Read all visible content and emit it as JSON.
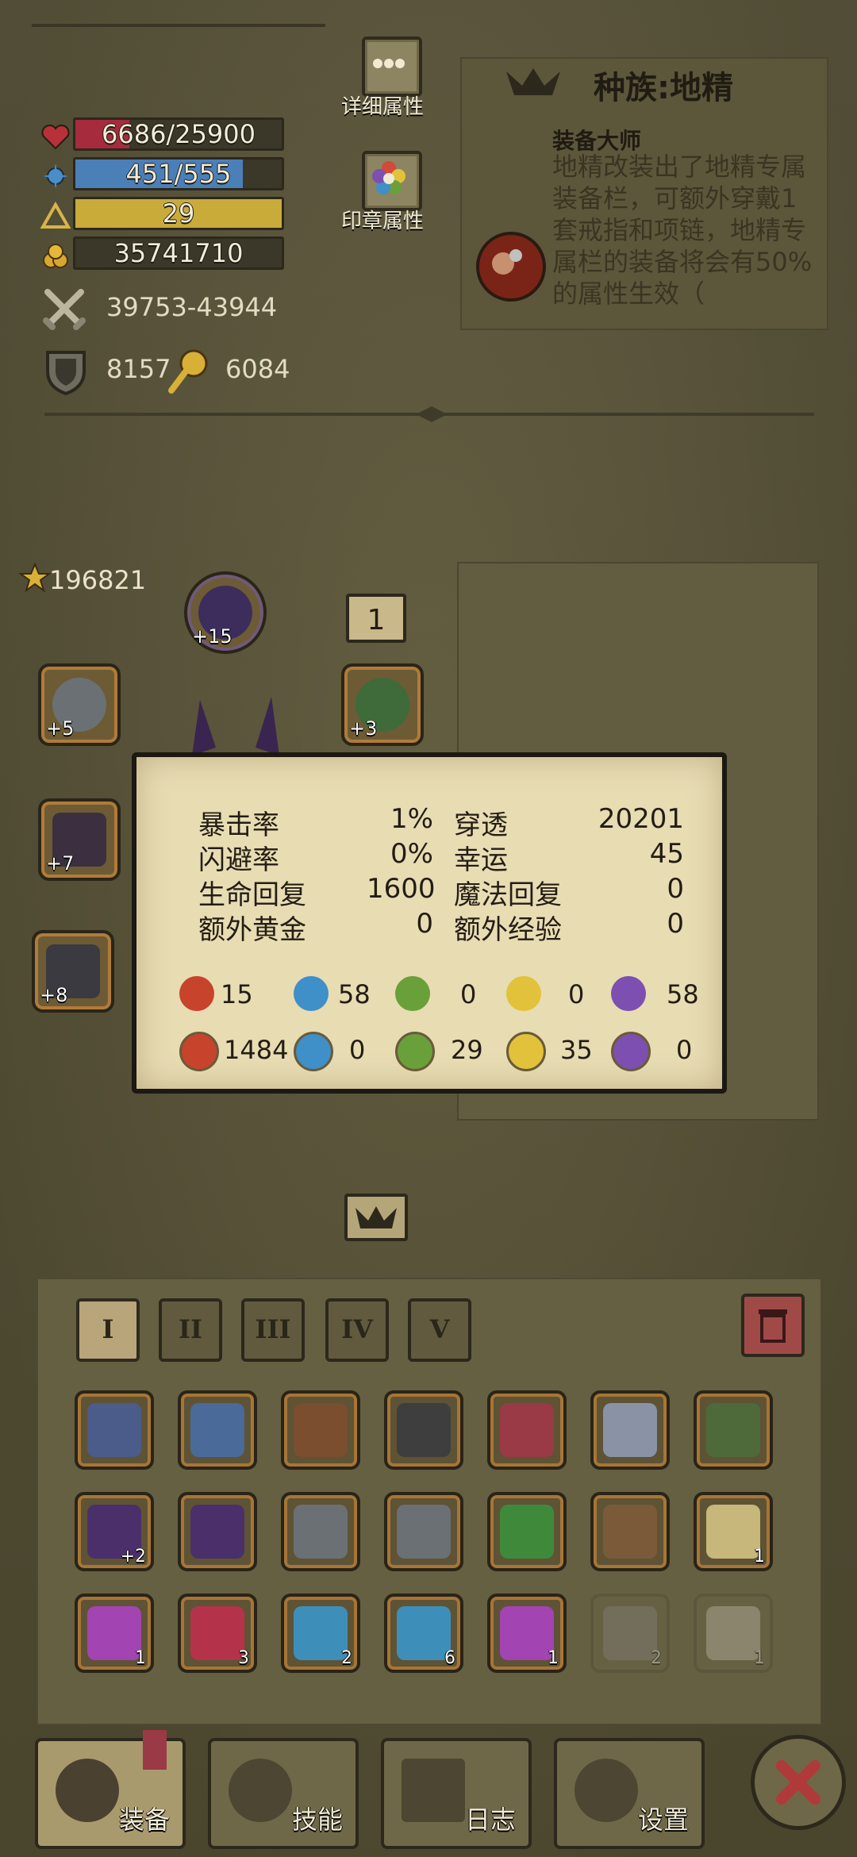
{
  "stats": {
    "hp": "6686/25900",
    "hp_fraction": 0.26,
    "mp": "451/555",
    "mp_fraction": 0.81,
    "level": "29",
    "gold": "35741710",
    "attack": "39753-43944",
    "defense": "8157",
    "magic_defense": "6084"
  },
  "buttons": {
    "details": "详细属性",
    "seal": "印章属性"
  },
  "race": {
    "title": "种族:地精",
    "skill_name": "装备大师",
    "skill_desc": "地精改装出了地精专属装备栏，可额外穿戴1套戒指和项链，地精专属栏的装备将会有50%的属性生效（"
  },
  "power": "196821",
  "equip_badge": "1",
  "equipped": [
    {
      "name": "helmet",
      "plus": "+15"
    },
    {
      "name": "ring-left",
      "plus": "+5"
    },
    {
      "name": "ring-right",
      "plus": "+3"
    },
    {
      "name": "weapon",
      "plus": "+7"
    },
    {
      "name": "gauntlet",
      "plus": "+8"
    }
  ],
  "tooltip": {
    "rows": [
      {
        "l1": "暴击率",
        "v1": "1%",
        "l2": "穿透",
        "v2": "20201"
      },
      {
        "l1": "闪避率",
        "v1": "0%",
        "l2": "幸运",
        "v2": "45"
      },
      {
        "l1": "生命回复",
        "v1": "1600",
        "l2": "魔法回复",
        "v2": "0"
      },
      {
        "l1": "额外黄金",
        "v1": "0",
        "l2": "额外经验",
        "v2": "0"
      }
    ],
    "attack_elements": [
      "15",
      "58",
      "0",
      "0",
      "58"
    ],
    "resist_elements": [
      "1484",
      "0",
      "29",
      "35",
      "0"
    ],
    "element_colors": [
      "#c8432b",
      "#3f8fc8",
      "#6aa03a",
      "#e2c23a",
      "#7d4fb0"
    ]
  },
  "tabs": [
    "I",
    "II",
    "III",
    "IV",
    "V"
  ],
  "inventory": [
    {
      "name": "spiked-mace",
      "count": "",
      "color": "#4b5c8a"
    },
    {
      "name": "winged-amulet",
      "count": "",
      "color": "#4a6a9a"
    },
    {
      "name": "beast-armor",
      "count": "",
      "color": "#7a4e2e"
    },
    {
      "name": "iron-helm",
      "count": "",
      "color": "#3e3e3e"
    },
    {
      "name": "red-shield",
      "count": "",
      "color": "#9a3a46"
    },
    {
      "name": "plate-greaves",
      "count": "",
      "color": "#8a93a6"
    },
    {
      "name": "green-boots",
      "count": "",
      "color": "#4f6a3a"
    },
    {
      "name": "purple-wings-locked",
      "count": "+2",
      "color": "#4a2f6a"
    },
    {
      "name": "purple-wings",
      "count": "",
      "color": "#4a2f6a"
    },
    {
      "name": "ring-a",
      "count": "",
      "color": "#6b7074"
    },
    {
      "name": "ring-b",
      "count": "",
      "color": "#6b7074"
    },
    {
      "name": "emerald-necklace",
      "count": "",
      "color": "#3f8a3a"
    },
    {
      "name": "star-ring",
      "count": "",
      "color": "#7b5a3a"
    },
    {
      "name": "scroll",
      "count": "1",
      "color": "#c7b77a"
    },
    {
      "name": "purple-potion",
      "count": "1",
      "color": "#a244b2"
    },
    {
      "name": "red-potion",
      "count": "3",
      "color": "#b4334a"
    },
    {
      "name": "blue-potion",
      "count": "2",
      "color": "#3d8fba"
    },
    {
      "name": "big-blue-potion",
      "count": "6",
      "color": "#3d8fba"
    },
    {
      "name": "big-purple-potion",
      "count": "1",
      "color": "#a244b2"
    },
    {
      "name": "compass",
      "count": "2",
      "color": "#8a8a8a"
    },
    {
      "name": "bone",
      "count": "1",
      "color": "#d0cbbb"
    }
  ],
  "nav": {
    "equip": "装备",
    "skills": "技能",
    "log": "日志",
    "settings": "设置"
  }
}
